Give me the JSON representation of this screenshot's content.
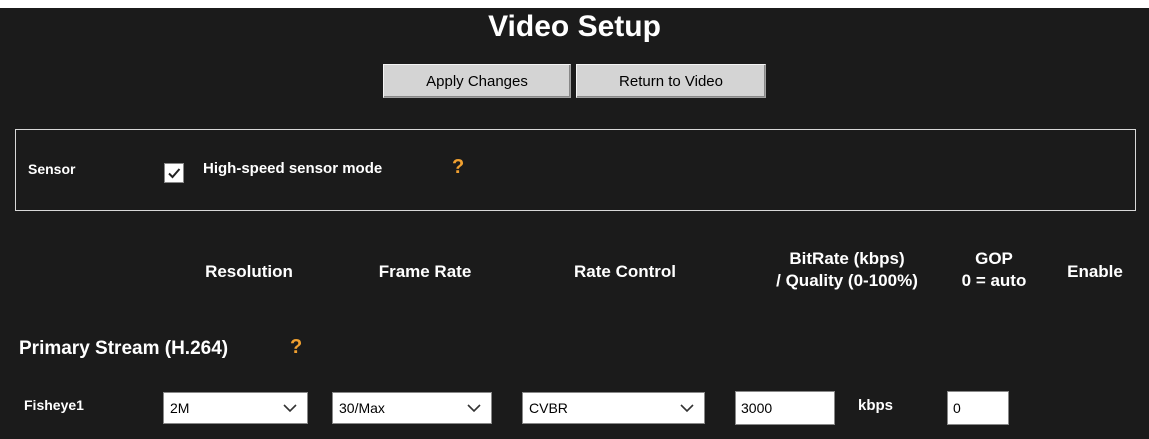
{
  "page": {
    "title": "Video Setup"
  },
  "toolbar": {
    "apply_label": "Apply Changes",
    "return_label": "Return to Video"
  },
  "sensor": {
    "label": "Sensor",
    "high_speed_label": "High-speed sensor mode",
    "high_speed_checked": true,
    "help": "?"
  },
  "columns": {
    "resolution": "Resolution",
    "frame_rate": "Frame Rate",
    "rate_control": "Rate Control",
    "bitrate_line1": "BitRate (kbps)",
    "bitrate_line2": "/ Quality (0-100%)",
    "gop_line1": "GOP",
    "gop_line2": "0 = auto",
    "enable": "Enable"
  },
  "primary": {
    "title": "Primary Stream (H.264)",
    "help": "?",
    "row": {
      "label": "Fisheye1",
      "resolution": "2M",
      "frame_rate": "30/Max",
      "rate_control": "CVBR",
      "bitrate": "3000",
      "bitrate_unit": "kbps",
      "gop": "0"
    }
  }
}
